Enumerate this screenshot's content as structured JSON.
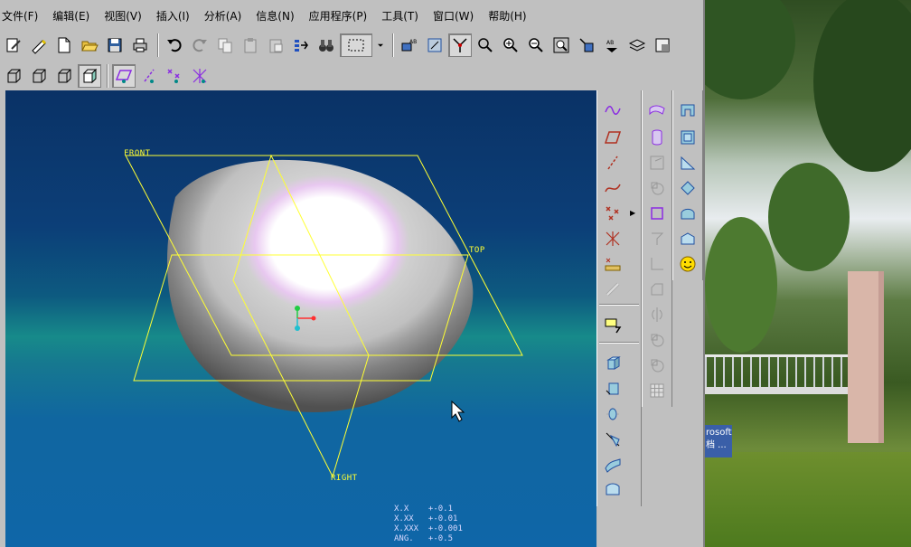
{
  "menu": [
    "文件(F)",
    "编辑(E)",
    "视图(V)",
    "插入(I)",
    "分析(A)",
    "信息(N)",
    "应用程序(P)",
    "工具(T)",
    "窗口(W)",
    "帮助(H)"
  ],
  "viewport": {
    "datum_planes": {
      "front": "FRONT",
      "top": "TOP",
      "right": "RIGHT"
    },
    "tolerance_lines": [
      "X.X    +-0.1",
      "X.XX   +-0.01",
      "X.XXX  +-0.001",
      "ANG.   +-0.5"
    ]
  },
  "desktop": {
    "taskbar_hint_lines": [
      "rosoft",
      "档 ..."
    ]
  },
  "colors": {
    "datum_plane": "#ffff33",
    "background_top": "#0a3266",
    "background_bottom": "#0f66a8",
    "palette_accent": "#8a2be2"
  }
}
